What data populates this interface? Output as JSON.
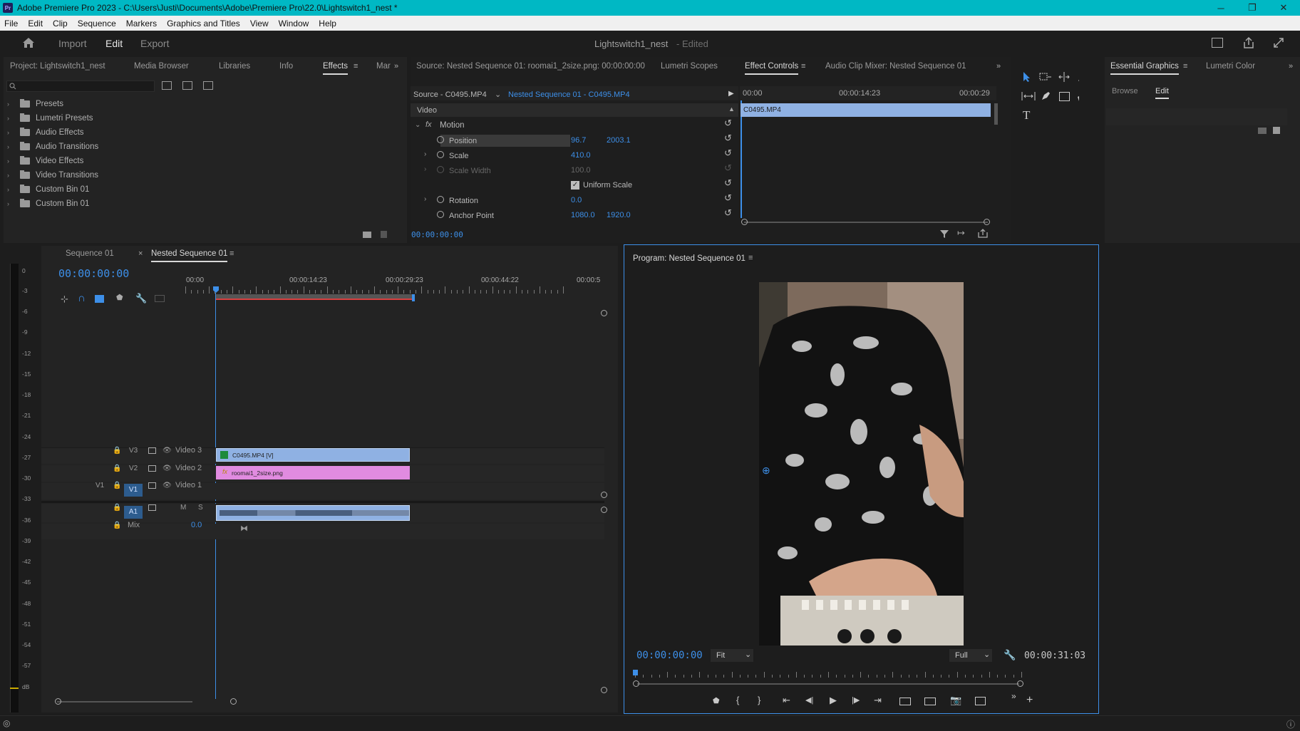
{
  "window": {
    "app_badge": "Pr",
    "title": "Adobe Premiere Pro 2023 - C:\\Users\\Justi\\Documents\\Adobe\\Premiere Pro\\22.0\\Lightswitch1_nest *",
    "minimize": "─",
    "restore": "❐",
    "close": "✕"
  },
  "menu": [
    "File",
    "Edit",
    "Clip",
    "Sequence",
    "Markers",
    "Graphics and Titles",
    "View",
    "Window",
    "Help"
  ],
  "workspace": {
    "tabs": [
      "Import",
      "Edit",
      "Export"
    ],
    "active": "Edit",
    "project_title": "Lightswitch1_nest",
    "project_status": "- Edited"
  },
  "project_panel": {
    "tabs": [
      "Project: Lightswitch1_nest",
      "Media Browser",
      "Libraries",
      "Info",
      "Effects",
      "Mar"
    ],
    "active": "Effects",
    "items": [
      "Presets",
      "Lumetri Presets",
      "Audio Effects",
      "Audio Transitions",
      "Video Effects",
      "Video Transitions",
      "Custom Bin 01",
      "Custom Bin 01"
    ]
  },
  "source_panel": {
    "tabs": [
      "Source: Nested Sequence 01: roomai1_2size.png: 00:00:00:00",
      "Lumetri Scopes",
      "Effect Controls",
      "Audio Clip Mixer: Nested Sequence 01"
    ],
    "active": "Effect Controls",
    "source_label": "Source - C0495.MP4",
    "sequence_label": "Nested Sequence 01 - C0495.MP4",
    "section": "Video",
    "group": "Motion",
    "fx_badge": "fx",
    "props": [
      {
        "name": "Position",
        "v1": "96.7",
        "v2": "2003.1"
      },
      {
        "name": "Scale",
        "v1": "410.0",
        "v2": ""
      },
      {
        "name": "Scale Width",
        "v1": "100.0",
        "v2": ""
      },
      {
        "name": "Uniform Scale",
        "v1": "",
        "v2": ""
      },
      {
        "name": "Rotation",
        "v1": "0.0",
        "v2": ""
      },
      {
        "name": "Anchor Point",
        "v1": "1080.0",
        "v2": "1920.0"
      }
    ],
    "mini_ruler": [
      "00:00",
      "00:00:14:23",
      "00:00:29"
    ],
    "clip_name": "C0495.MP4",
    "timecode": "00:00:00:00"
  },
  "essential_graphics": {
    "tabs": [
      "Essential Graphics",
      "Lumetri Color"
    ],
    "active": "Essential Graphics",
    "subtabs": [
      "Browse",
      "Edit"
    ],
    "active_subtab": "Edit"
  },
  "timeline": {
    "tabs": [
      "Sequence 01",
      "Nested Sequence 01"
    ],
    "active": "Nested Sequence 01",
    "timecode": "00:00:00:00",
    "ruler": [
      "00:00",
      "00:00:14:23",
      "00:00:29:23",
      "00:00:44:22",
      "00:00:5"
    ],
    "tracks": [
      {
        "target": "",
        "id": "V3",
        "name": "Video 3"
      },
      {
        "target": "",
        "id": "V2",
        "name": "Video 2"
      },
      {
        "target": "V1",
        "id": "V1",
        "name": "Video 1"
      },
      {
        "target": "",
        "id": "A1",
        "name": "M",
        "solo": "S"
      }
    ],
    "mix_label": "Mix",
    "mix_value": "0.0",
    "clips": {
      "v3": "C0495.MP4 [V]",
      "v2": "roomai1_2size.png",
      "fx": "fx"
    }
  },
  "meter": [
    "0",
    "-3",
    "-6",
    "-9",
    "-12",
    "-15",
    "-18",
    "-21",
    "-24",
    "-27",
    "-30",
    "-33",
    "-36",
    "-39",
    "-42",
    "-45",
    "-48",
    "-51",
    "-54",
    "-57",
    "dB"
  ],
  "program_monitor": {
    "title": "Program: Nested Sequence 01",
    "timecode": "00:00:00:00",
    "fit": "Fit",
    "quality": "Full",
    "duration": "00:00:31:03"
  },
  "colors": {
    "accent": "#3d8fe8",
    "titlebar": "#00b8c4",
    "clip_video": "#8fb1e3",
    "clip_graphic": "#e18be0",
    "clip_audio": "#8fb1e3",
    "workarea": "#d94040"
  }
}
